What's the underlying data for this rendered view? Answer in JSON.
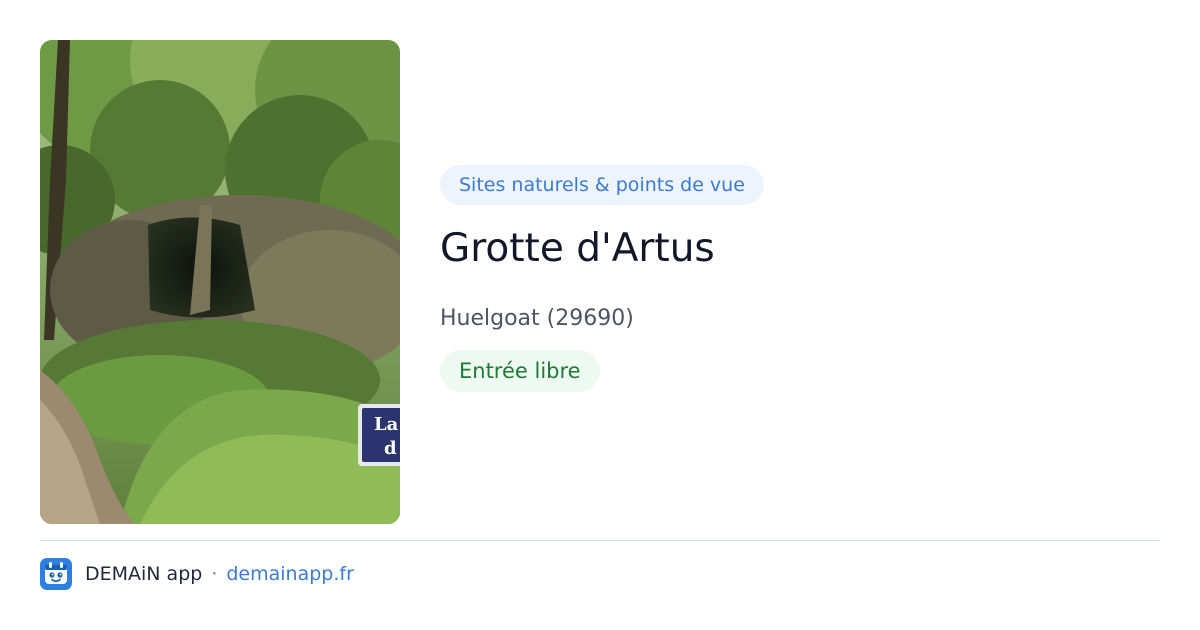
{
  "card": {
    "category": "Sites naturels & points de vue",
    "title": "Grotte d'Artus",
    "location": "Huelgoat (29690)",
    "access": "Entrée libre",
    "photo_sign_text": "La d"
  },
  "footer": {
    "app_name": "DEMAiN app",
    "separator": "·",
    "url": "demainapp.fr",
    "app_icon": "demain-app-icon"
  },
  "colors": {
    "category_text": "#3a7bd5",
    "category_bg": "#eef4fc",
    "access_text": "#1f7a37",
    "access_bg": "#eefaf1",
    "title": "#111827",
    "link": "#3a7bd5"
  }
}
